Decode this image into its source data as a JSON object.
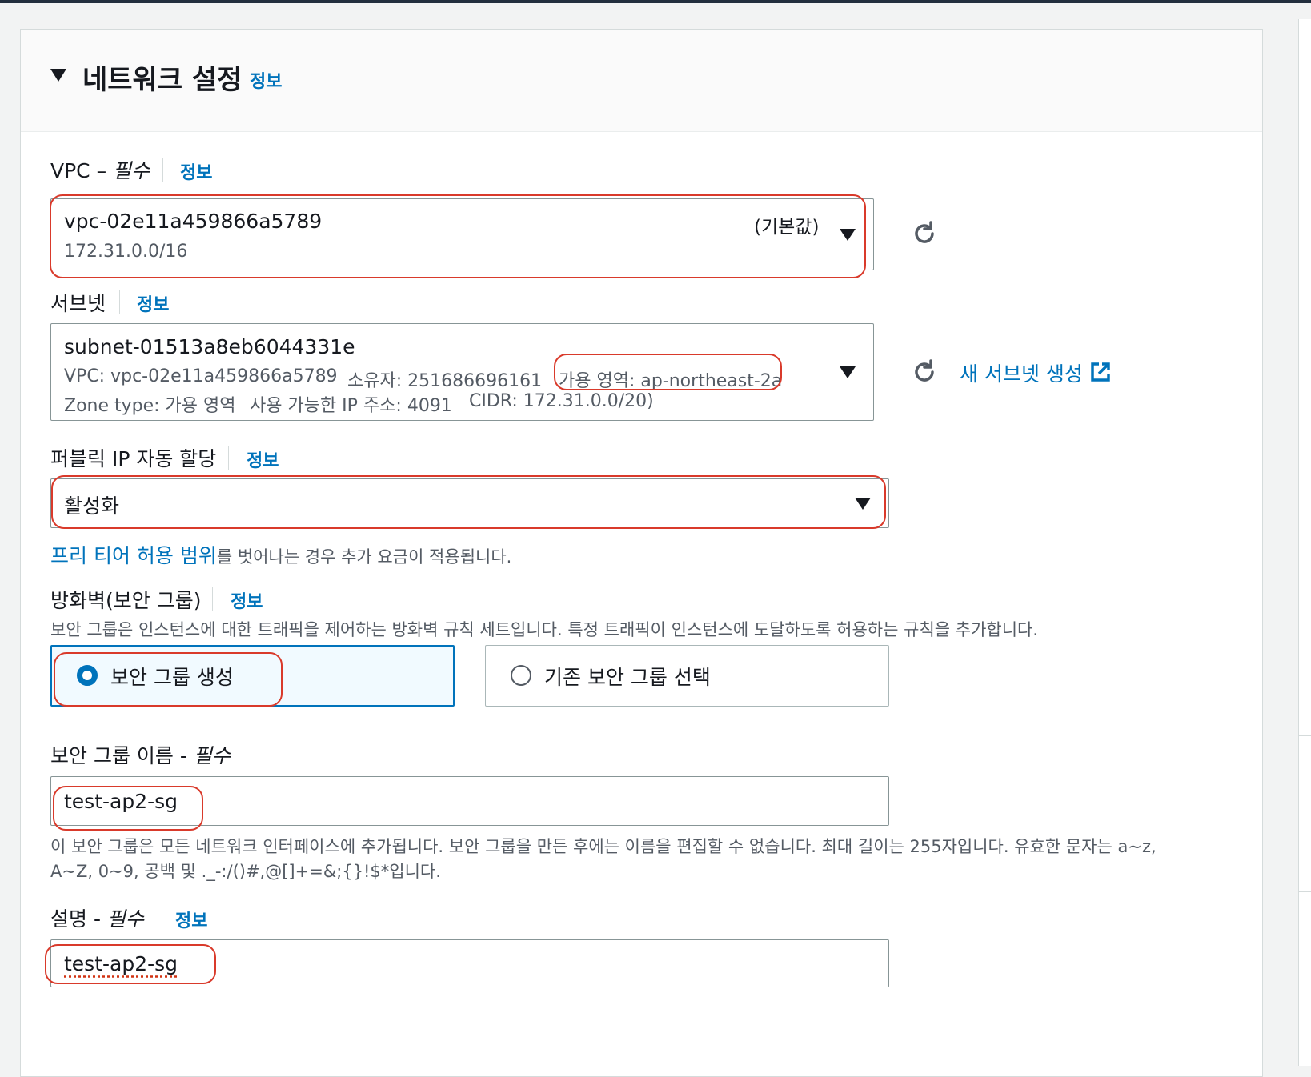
{
  "section": {
    "title": "네트워크 설정",
    "info_link": "정보"
  },
  "vpc": {
    "label": "VPC – ",
    "required": "필수",
    "info_link": "정보",
    "value": "vpc-02e11a459866a5789",
    "default_tag": "(기본값)",
    "cidr": "172.31.0.0/16"
  },
  "subnet": {
    "label": "서브넷",
    "info_link": "정보",
    "value": "subnet-01513a8eb6044331e",
    "vpc_line": "VPC: vpc-02e11a459866a5789",
    "owner_line": "소유자: 251686696161",
    "az_line": "가용 영역: ap-northeast-2a",
    "zone_type_line": "Zone type: 가용 영역",
    "ip_line": "사용 가능한 IP 주소: 4091",
    "cidr_line": "CIDR: 172.31.0.0/20)",
    "create_link": "새 서브넷 생성"
  },
  "public_ip": {
    "label": "퍼블릭 IP 자동 할당",
    "info_link": "정보",
    "value": "활성화",
    "free_tier_link": "프리 티어 허용 범위",
    "free_tier_note": "를 벗어나는 경우 추가 요금이 적용됩니다."
  },
  "firewall": {
    "label": "방화벽(보안 그룹)",
    "info_link": "정보",
    "description": "보안 그룹은 인스턴스에 대한 트래픽을 제어하는 방화벽 규칙 세트입니다. 특정 트래픽이 인스턴스에 도달하도록 허용하는 규칙을 추가합니다.",
    "option_create": "보안 그룹 생성",
    "option_existing": "기존 보안 그룹 선택",
    "selected": "보안 그룹 생성"
  },
  "sg_name": {
    "label": "보안 그룹 이름 - ",
    "required": "필수",
    "value": "test-ap2-sg",
    "help_line1": "이 보안 그룹은 모든 네트워크 인터페이스에 추가됩니다. 보안 그룹을 만든 후에는 이름을 편집할 수 없습니다. 최대 길이는 255자입니다. 유효한 문자는 a~z,",
    "help_line2": "A~Z, 0~9, 공백 및 ._-:/()#,@[]+=&;{}!$*입니다."
  },
  "sg_desc": {
    "label": "설명 - ",
    "required": "필수",
    "info_link": "정보",
    "value": "test-ap2-sg"
  },
  "colors": {
    "accent": "#0073bb",
    "annotation_red": "#d93a2b",
    "text": "#16191f",
    "muted": "#545b64"
  }
}
